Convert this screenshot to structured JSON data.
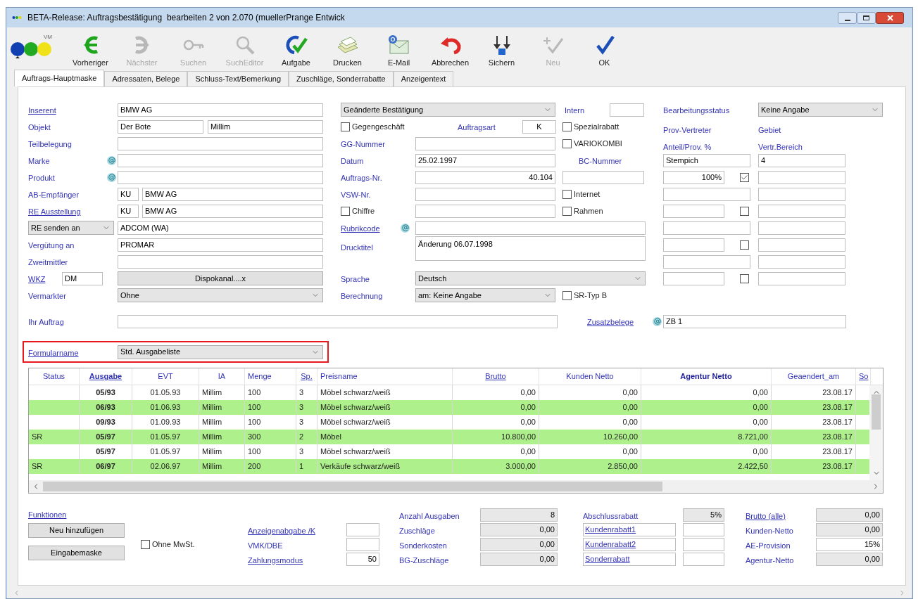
{
  "window": {
    "title": "BETA-Release: Auftragsbestätigung  bearbeiten 2 von 2.070 (muellerPrange Entwick"
  },
  "logo": {
    "text": "VM"
  },
  "toolbar": [
    {
      "kind": "back",
      "label": "Vorheriger",
      "disabled": false
    },
    {
      "kind": "next",
      "label": "Nächster",
      "disabled": true
    },
    {
      "kind": "key",
      "label": "Suchen",
      "disabled": true
    },
    {
      "kind": "magnifier",
      "label": "SuchEditor",
      "disabled": true
    },
    {
      "kind": "task",
      "label": "Aufgabe",
      "disabled": false
    },
    {
      "kind": "print",
      "label": "Drucken",
      "disabled": false
    },
    {
      "kind": "mail",
      "label": "E-Mail",
      "disabled": false
    },
    {
      "kind": "cancel",
      "label": "Abbrechen",
      "disabled": false
    },
    {
      "kind": "save",
      "label": "Sichern",
      "disabled": false
    },
    {
      "kind": "new",
      "label": "Neu",
      "disabled": true
    },
    {
      "kind": "ok",
      "label": "OK",
      "disabled": false
    }
  ],
  "tabs": [
    {
      "label": "Auftrags-Hauptmaske",
      "selected": true
    },
    {
      "label": "Adressaten, Belege",
      "selected": false
    },
    {
      "label": "Schluss-Text/Bemerkung",
      "selected": false
    },
    {
      "label": "Zuschläge, Sonderrabatte",
      "selected": false
    },
    {
      "label": "Anzeigentext",
      "selected": false
    }
  ],
  "inserent": {
    "label": "Inserent",
    "value": "BMW AG"
  },
  "objekt": {
    "label": "Objekt",
    "value": "Der Bote",
    "value_2": "Millim"
  },
  "teilbelegung": {
    "label": "Teilbelegung"
  },
  "marke": {
    "label": "Marke"
  },
  "produkt": {
    "label": "Produkt"
  },
  "ab_empfaenger": {
    "label": "AB-Empfänger",
    "code": "KU",
    "value": "BMW AG"
  },
  "re_ausstellung": {
    "label": "RE Ausstellung",
    "code": "KU",
    "value": "BMW AG"
  },
  "re_senden_an": {
    "option": "RE senden an",
    "value": "ADCOM (WA)"
  },
  "verguetung_an": {
    "label": "Vergütung an",
    "value": "PROMAR"
  },
  "zweitmittler": {
    "label": "Zweitmittler"
  },
  "wkz": {
    "label": "WKZ",
    "value": "DM",
    "button": "Dispokanal....x"
  },
  "vermarkter": {
    "label": "Vermarkter",
    "value": "Ohne"
  },
  "bestaetigung": {
    "value": "Geänderte Bestätigung"
  },
  "intern": {
    "label": "Intern"
  },
  "gegengeschaeft": {
    "label": "Gegengeschäft",
    "checked": false
  },
  "auftragsart": {
    "label": "Auftragsart",
    "value": "K"
  },
  "spezialrabatt": {
    "label": "Spezialrabatt",
    "checked": false
  },
  "gg_nummer": {
    "label": "GG-Nummer"
  },
  "variokombi": {
    "label": "VARIOKOMBI",
    "checked": false
  },
  "datum": {
    "label": "Datum",
    "value": "25.02.1997"
  },
  "bc_nummer": {
    "label": "BC-Nummer"
  },
  "auftrags_nr": {
    "label": "Auftrags-Nr.",
    "value": "40.104"
  },
  "vsw_nr": {
    "label": "VSW-Nr."
  },
  "internet": {
    "label": "Internet",
    "checked": false
  },
  "chiffre": {
    "label": "Chiffre",
    "checked": false
  },
  "rahmen": {
    "label": "Rahmen",
    "checked": false
  },
  "rubrikcode": {
    "label": "Rubrikcode"
  },
  "drucktitel": {
    "label": "Drucktitel",
    "value": "Änderung 06.07.1998"
  },
  "sprache": {
    "label": "Sprache",
    "value": "Deutsch"
  },
  "berechnung": {
    "label": "Berechnung",
    "value": "am: Keine Angabe"
  },
  "sr_typ_b": {
    "label": "SR-Typ B",
    "checked": false
  },
  "bearbeitungsstatus": {
    "label": "Bearbeitungsstatus",
    "value": "Keine Angabe"
  },
  "prov_header": [
    "Prov-Vertreter",
    "Anteil/Prov. %"
  ],
  "gebiet_header": [
    "Gebiet",
    "Vertr.Bereich"
  ],
  "vertreter_rows": [
    {
      "kind": "name",
      "value": "Stempich",
      "gebiet": "4"
    },
    {
      "kind": "share",
      "value": "100%",
      "checked": true
    },
    {
      "kind": "name"
    },
    {
      "kind": "share",
      "checked": false
    },
    {
      "kind": "name"
    },
    {
      "kind": "share",
      "checked": false
    },
    {
      "kind": "name"
    },
    {
      "kind": "share",
      "checked": false
    }
  ],
  "ihr_auftrag": {
    "label": "Ihr Auftrag"
  },
  "zusatzbelege": {
    "label": "Zusatzbelege",
    "value": "ZB 1"
  },
  "formularname": {
    "label": "Formularname",
    "value": "Std. Ausgabeliste"
  },
  "table": {
    "columns": [
      {
        "label": "Status",
        "kind": "plain"
      },
      {
        "label": "Ausgabe",
        "kind": "sorted"
      },
      {
        "label": "EVT",
        "kind": "plain"
      },
      {
        "label": "IA",
        "kind": "plain"
      },
      {
        "label": "Menge",
        "kind": "plain"
      },
      {
        "label": "Sp.",
        "kind": "link"
      },
      {
        "label": "Preisname",
        "kind": "plain"
      },
      {
        "label": "Brutto",
        "kind": "link"
      },
      {
        "label": "Kunden Netto",
        "kind": "plain"
      },
      {
        "label": "Agentur Netto",
        "kind": "emphasis"
      },
      {
        "label": "Geaendert_am",
        "kind": "plain"
      },
      {
        "label": "So",
        "kind": "link"
      }
    ],
    "rows": [
      {
        "highlighted": false,
        "ausgabe": "05/93",
        "evt": "01.05.93",
        "ia": "Millim",
        "menge": "100",
        "sp": "3",
        "preisname": "Möbel schwarz/weiß",
        "brutto": "0,00",
        "kunden_netto": "0,00",
        "agentur_netto": "0,00",
        "geaendert_am": "23.08.17"
      },
      {
        "highlighted": true,
        "ausgabe": "06/93",
        "evt": "01.06.93",
        "ia": "Millim",
        "menge": "100",
        "sp": "3",
        "preisname": "Möbel schwarz/weiß",
        "brutto": "0,00",
        "kunden_netto": "0,00",
        "agentur_netto": "0,00",
        "geaendert_am": "23.08.17"
      },
      {
        "highlighted": false,
        "ausgabe": "09/93",
        "evt": "01.09.93",
        "ia": "Millim",
        "menge": "100",
        "sp": "3",
        "preisname": "Möbel schwarz/weiß",
        "brutto": "0,00",
        "kunden_netto": "0,00",
        "agentur_netto": "0,00",
        "geaendert_am": "23.08.17"
      },
      {
        "highlighted": true,
        "status": "SR",
        "ausgabe": "05/97",
        "evt": "01.05.97",
        "ia": "Millim",
        "menge": "300",
        "sp": "2",
        "preisname": "Möbel",
        "brutto": "10.800,00",
        "kunden_netto": "10.260,00",
        "agentur_netto": "8.721,00",
        "geaendert_am": "23.08.17"
      },
      {
        "highlighted": false,
        "ausgabe": "05/97",
        "evt": "01.05.97",
        "ia": "Millim",
        "menge": "100",
        "sp": "3",
        "preisname": "Möbel schwarz/weiß",
        "brutto": "0,00",
        "kunden_netto": "0,00",
        "agentur_netto": "0,00",
        "geaendert_am": "23.08.17"
      },
      {
        "highlighted": true,
        "status": "SR",
        "ausgabe": "06/97",
        "evt": "02.06.97",
        "ia": "Millim",
        "menge": "200",
        "sp": "1",
        "preisname": "Verkäufe schwarz/weiß",
        "brutto": "3.000,00",
        "kunden_netto": "2.850,00",
        "agentur_netto": "2.422,50",
        "geaendert_am": "23.08.17"
      }
    ]
  },
  "funktionen": {
    "label": "Funktionen",
    "buttons": [
      "Neu hinzufügen",
      "Eingabemaske"
    ]
  },
  "ohne_mwst": {
    "label": "Ohne MwSt.",
    "checked": false
  },
  "col_b": [
    {
      "kind": "link",
      "label": "Anzeigenabgabe /K"
    },
    {
      "kind": "text",
      "label": "VMK/DBE"
    },
    {
      "kind": "link",
      "label": "Zahlungsmodus",
      "value": "50"
    }
  ],
  "col_c": [
    {
      "label": "Anzahl Ausgaben",
      "value": "8",
      "readonly": true
    },
    {
      "label": "Zuschläge",
      "value": "0,00",
      "readonly": true
    },
    {
      "label": "Sonderkosten",
      "value": "0,00",
      "readonly": true
    },
    {
      "label": "BG-Zuschläge",
      "value": "0,00",
      "readonly": true
    }
  ],
  "col_d": [
    {
      "kind": "text",
      "label": "Abschlussrabatt",
      "value": "5%",
      "readonly": true
    },
    {
      "kind": "linkbox",
      "label": "Kundenrabatt1",
      "readonly": false
    },
    {
      "kind": "linkbox",
      "label": "Kundenrabatt2",
      "readonly": false
    },
    {
      "kind": "linkbox",
      "label": "Sonderrabatt",
      "readonly": false
    }
  ],
  "col_e": [
    {
      "kind": "link",
      "label": "Brutto (alle)",
      "value": "0,00",
      "readonly": true
    },
    {
      "kind": "text",
      "label": "Kunden-Netto",
      "value": "0,00",
      "readonly": true
    },
    {
      "kind": "text",
      "label": "AE-Provision",
      "value": "15%",
      "readonly": false
    },
    {
      "kind": "text",
      "label": "Agentur-Netto",
      "value": "0,00",
      "readonly": true
    }
  ]
}
